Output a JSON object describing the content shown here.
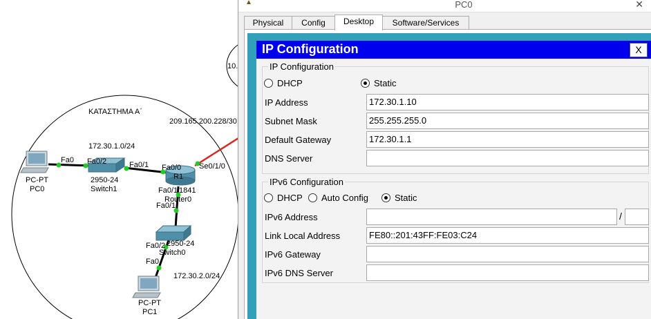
{
  "topology": {
    "area_label": "ΚΑΤΑΣΤΗΜΑ Α΄",
    "net1_label": "172.30.1.0/24",
    "net2_label": "172.30.2.0/24",
    "wan_label": "209.165.200.228/30",
    "cut_label": "10.",
    "pc0": {
      "type": "PC-PT",
      "name": "PC0",
      "port": "Fa0"
    },
    "pc1": {
      "type": "PC-PT",
      "name": "PC1",
      "port": "Fa0"
    },
    "switch1": {
      "model": "2950-24",
      "name": "Switch1",
      "port_a": "Fa0/2",
      "port_b": "Fa0/1"
    },
    "switch0": {
      "model": "2950-24",
      "name": "Switch0",
      "port_a": "Fa0/1",
      "port_b": "Fa0/2"
    },
    "router": {
      "name": "R1",
      "model": "1841",
      "hostname": "Router0",
      "port_a": "Fa0/0",
      "port_b": "Fa0/1",
      "port_c": "Se0/1/0"
    },
    "colors": {
      "link": "#000000",
      "serial": "#e0231b",
      "port_dot": "#22cc22",
      "circle": "#000000"
    }
  },
  "window": {
    "title": "PC0",
    "close_glyph": "✕",
    "tabs": [
      {
        "label": "Physical",
        "active": false
      },
      {
        "label": "Config",
        "active": false
      },
      {
        "label": "Desktop",
        "active": true
      },
      {
        "label": "Software/Services",
        "active": false
      }
    ],
    "desktop_bg": "#33a0ba"
  },
  "ipconfig": {
    "title": "IP Configuration",
    "close_label": "X",
    "title_bar_color": "#0000ee",
    "ipv4": {
      "group_title": "IP Configuration",
      "dhcp_label": "DHCP",
      "static_label": "Static",
      "mode": "static",
      "ip_label": "IP Address",
      "ip_value": "172.30.1.10",
      "mask_label": "Subnet Mask",
      "mask_value": "255.255.255.0",
      "gw_label": "Default Gateway",
      "gw_value": "172.30.1.1",
      "dns_label": "DNS Server",
      "dns_value": ""
    },
    "ipv6": {
      "group_title": "IPv6 Configuration",
      "dhcp_label": "DHCP",
      "auto_label": "Auto Config",
      "static_label": "Static",
      "mode": "static",
      "addr_label": "IPv6 Address",
      "addr_value": "",
      "prefix_sep": "/",
      "prefix_value": "",
      "link_local_label": "Link Local Address",
      "link_local_value": "FE80::201:43FF:FE03:C24",
      "gw_label": "IPv6 Gateway",
      "gw_value": "",
      "dns_label": "IPv6 DNS Server",
      "dns_value": ""
    }
  }
}
